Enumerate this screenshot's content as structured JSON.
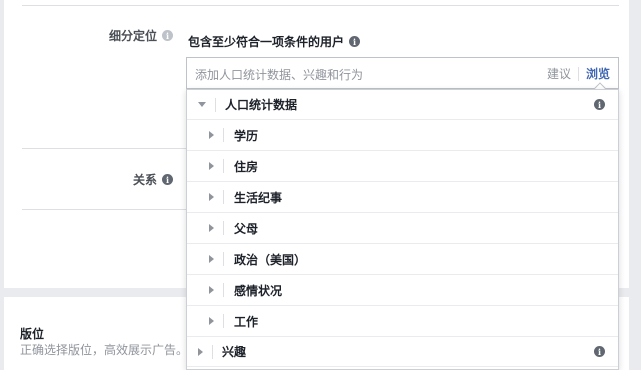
{
  "targeting": {
    "label": "细分定位",
    "criteria_text": "包含至少符合一项条件的用户",
    "input_placeholder": "添加人口统计数据、兴趣和行为",
    "suggest_label": "建议",
    "browse_label": "浏览"
  },
  "relationship": {
    "label": "关系"
  },
  "placement": {
    "title": "版位",
    "description": "正确选择版位，高效展示广告。"
  },
  "dropdown": {
    "header_label": "人口统计数据",
    "items": [
      {
        "label": "学历"
      },
      {
        "label": "住房"
      },
      {
        "label": "生活纪事"
      },
      {
        "label": "父母"
      },
      {
        "label": "政治（美国）"
      },
      {
        "label": "感情状况"
      },
      {
        "label": "工作"
      },
      {
        "label": "兴趣"
      }
    ]
  },
  "colors": {
    "background": "#e9ebee",
    "panel": "#ffffff",
    "link": "#4267b2",
    "muted_text": "#90949c"
  },
  "icons": {
    "info": "info-icon",
    "expand": "caret-right-icon",
    "collapse": "caret-down-icon"
  }
}
